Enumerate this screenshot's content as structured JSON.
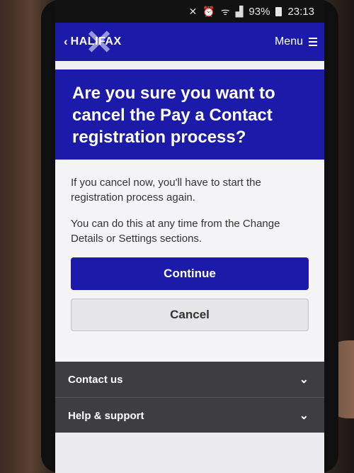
{
  "status_bar": {
    "battery": "93%",
    "time": "23:13"
  },
  "header": {
    "logo_text": "HALIFAX",
    "menu_label": "Menu"
  },
  "dialog": {
    "title": "Are you sure you want to cancel the Pay a Contact registration process?",
    "paragraph_1": "If you cancel now, you'll have to start the registration process again.",
    "paragraph_2": "You can do this at any time from the Change Details or Settings sections.",
    "continue_label": "Continue",
    "cancel_label": "Cancel"
  },
  "footer": {
    "items": [
      {
        "label": "Contact us",
        "icon": "chevron-down-icon"
      },
      {
        "label": "Help & support",
        "icon": "chevron-down-icon"
      }
    ]
  },
  "colors": {
    "brand_blue": "#1c1aa8",
    "footer_grey": "#3e3e40",
    "button_grey": "#e6e6e8"
  }
}
